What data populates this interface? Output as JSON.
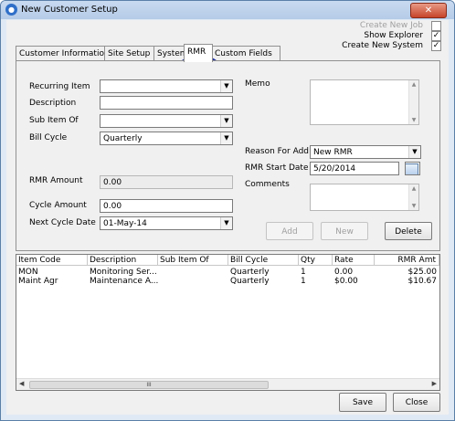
{
  "window": {
    "title": "New Customer Setup",
    "close_glyph": "✕"
  },
  "top_options": {
    "create_new_job": {
      "label": "Create New Job",
      "checked": false
    },
    "show_explorer": {
      "label": "Show Explorer",
      "checked": true
    },
    "create_new_system": {
      "label": "Create New System",
      "checked": true
    }
  },
  "tabs": [
    "Customer Information",
    "Site Setup",
    "System",
    "RMR",
    "Custom Fields"
  ],
  "active_tab": "RMR",
  "form": {
    "recurring_item": {
      "label": "Recurring Item",
      "value": ""
    },
    "description": {
      "label": "Description",
      "value": ""
    },
    "sub_item_of": {
      "label": "Sub Item Of",
      "value": ""
    },
    "bill_cycle": {
      "label": "Bill Cycle",
      "value": "Quarterly"
    },
    "rmr_amount": {
      "label": "RMR Amount",
      "value": "0.00"
    },
    "cycle_amount": {
      "label": "Cycle Amount",
      "value": "0.00"
    },
    "next_cycle_date": {
      "label": "Next Cycle Date",
      "value": "01-May-14"
    },
    "memo": {
      "label": "Memo",
      "value": ""
    },
    "reason_for_add": {
      "label": "Reason For Add",
      "value": "New RMR"
    },
    "rmr_start_date": {
      "label": "RMR Start Date",
      "value": "5/20/2014"
    },
    "comments": {
      "label": "Comments",
      "value": ""
    }
  },
  "buttons": {
    "add": "Add",
    "new": "New",
    "delete": "Delete",
    "save": "Save",
    "close": "Close"
  },
  "table": {
    "columns": [
      "Item Code",
      "Description",
      "Sub Item Of",
      "Bill Cycle",
      "Qty",
      "Rate",
      "RMR Amt"
    ],
    "rows": [
      [
        "MON",
        "Monitoring Ser...",
        "",
        "Quarterly",
        "1",
        "0.00",
        "$25.00"
      ],
      [
        "Maint Agr",
        "Maintenance A...",
        "",
        "Quarterly",
        "1",
        "$0.00",
        "$10.67"
      ]
    ],
    "scroll_thumb_glyph": "III"
  }
}
